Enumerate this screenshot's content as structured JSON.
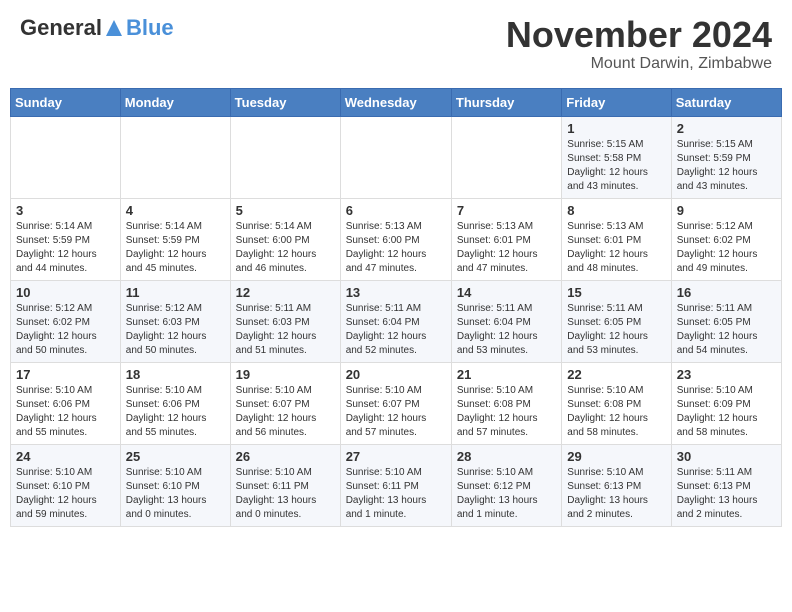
{
  "header": {
    "logo_general": "General",
    "logo_blue": "Blue",
    "month": "November 2024",
    "location": "Mount Darwin, Zimbabwe"
  },
  "weekdays": [
    "Sunday",
    "Monday",
    "Tuesday",
    "Wednesday",
    "Thursday",
    "Friday",
    "Saturday"
  ],
  "weeks": [
    [
      {
        "day": "",
        "info": ""
      },
      {
        "day": "",
        "info": ""
      },
      {
        "day": "",
        "info": ""
      },
      {
        "day": "",
        "info": ""
      },
      {
        "day": "",
        "info": ""
      },
      {
        "day": "1",
        "info": "Sunrise: 5:15 AM\nSunset: 5:58 PM\nDaylight: 12 hours\nand 43 minutes."
      },
      {
        "day": "2",
        "info": "Sunrise: 5:15 AM\nSunset: 5:59 PM\nDaylight: 12 hours\nand 43 minutes."
      }
    ],
    [
      {
        "day": "3",
        "info": "Sunrise: 5:14 AM\nSunset: 5:59 PM\nDaylight: 12 hours\nand 44 minutes."
      },
      {
        "day": "4",
        "info": "Sunrise: 5:14 AM\nSunset: 5:59 PM\nDaylight: 12 hours\nand 45 minutes."
      },
      {
        "day": "5",
        "info": "Sunrise: 5:14 AM\nSunset: 6:00 PM\nDaylight: 12 hours\nand 46 minutes."
      },
      {
        "day": "6",
        "info": "Sunrise: 5:13 AM\nSunset: 6:00 PM\nDaylight: 12 hours\nand 47 minutes."
      },
      {
        "day": "7",
        "info": "Sunrise: 5:13 AM\nSunset: 6:01 PM\nDaylight: 12 hours\nand 47 minutes."
      },
      {
        "day": "8",
        "info": "Sunrise: 5:13 AM\nSunset: 6:01 PM\nDaylight: 12 hours\nand 48 minutes."
      },
      {
        "day": "9",
        "info": "Sunrise: 5:12 AM\nSunset: 6:02 PM\nDaylight: 12 hours\nand 49 minutes."
      }
    ],
    [
      {
        "day": "10",
        "info": "Sunrise: 5:12 AM\nSunset: 6:02 PM\nDaylight: 12 hours\nand 50 minutes."
      },
      {
        "day": "11",
        "info": "Sunrise: 5:12 AM\nSunset: 6:03 PM\nDaylight: 12 hours\nand 50 minutes."
      },
      {
        "day": "12",
        "info": "Sunrise: 5:11 AM\nSunset: 6:03 PM\nDaylight: 12 hours\nand 51 minutes."
      },
      {
        "day": "13",
        "info": "Sunrise: 5:11 AM\nSunset: 6:04 PM\nDaylight: 12 hours\nand 52 minutes."
      },
      {
        "day": "14",
        "info": "Sunrise: 5:11 AM\nSunset: 6:04 PM\nDaylight: 12 hours\nand 53 minutes."
      },
      {
        "day": "15",
        "info": "Sunrise: 5:11 AM\nSunset: 6:05 PM\nDaylight: 12 hours\nand 53 minutes."
      },
      {
        "day": "16",
        "info": "Sunrise: 5:11 AM\nSunset: 6:05 PM\nDaylight: 12 hours\nand 54 minutes."
      }
    ],
    [
      {
        "day": "17",
        "info": "Sunrise: 5:10 AM\nSunset: 6:06 PM\nDaylight: 12 hours\nand 55 minutes."
      },
      {
        "day": "18",
        "info": "Sunrise: 5:10 AM\nSunset: 6:06 PM\nDaylight: 12 hours\nand 55 minutes."
      },
      {
        "day": "19",
        "info": "Sunrise: 5:10 AM\nSunset: 6:07 PM\nDaylight: 12 hours\nand 56 minutes."
      },
      {
        "day": "20",
        "info": "Sunrise: 5:10 AM\nSunset: 6:07 PM\nDaylight: 12 hours\nand 57 minutes."
      },
      {
        "day": "21",
        "info": "Sunrise: 5:10 AM\nSunset: 6:08 PM\nDaylight: 12 hours\nand 57 minutes."
      },
      {
        "day": "22",
        "info": "Sunrise: 5:10 AM\nSunset: 6:08 PM\nDaylight: 12 hours\nand 58 minutes."
      },
      {
        "day": "23",
        "info": "Sunrise: 5:10 AM\nSunset: 6:09 PM\nDaylight: 12 hours\nand 58 minutes."
      }
    ],
    [
      {
        "day": "24",
        "info": "Sunrise: 5:10 AM\nSunset: 6:10 PM\nDaylight: 12 hours\nand 59 minutes."
      },
      {
        "day": "25",
        "info": "Sunrise: 5:10 AM\nSunset: 6:10 PM\nDaylight: 13 hours\nand 0 minutes."
      },
      {
        "day": "26",
        "info": "Sunrise: 5:10 AM\nSunset: 6:11 PM\nDaylight: 13 hours\nand 0 minutes."
      },
      {
        "day": "27",
        "info": "Sunrise: 5:10 AM\nSunset: 6:11 PM\nDaylight: 13 hours\nand 1 minute."
      },
      {
        "day": "28",
        "info": "Sunrise: 5:10 AM\nSunset: 6:12 PM\nDaylight: 13 hours\nand 1 minute."
      },
      {
        "day": "29",
        "info": "Sunrise: 5:10 AM\nSunset: 6:13 PM\nDaylight: 13 hours\nand 2 minutes."
      },
      {
        "day": "30",
        "info": "Sunrise: 5:11 AM\nSunset: 6:13 PM\nDaylight: 13 hours\nand 2 minutes."
      }
    ]
  ]
}
